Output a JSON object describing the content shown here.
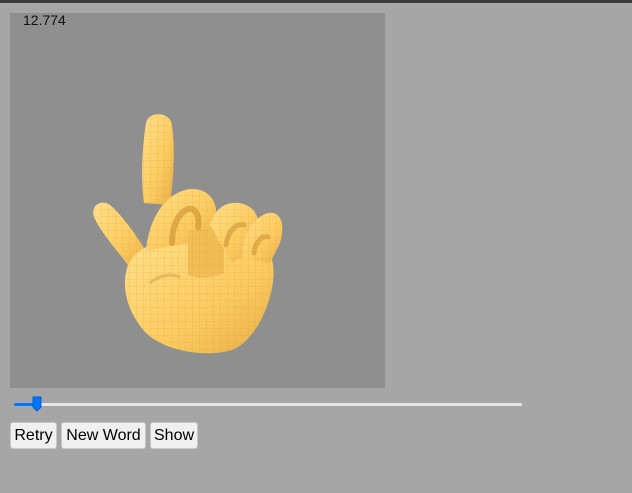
{
  "viewer": {
    "timer": "12.774",
    "model": "hand-sign-3d-model"
  },
  "slider": {
    "value_fraction": 0.027
  },
  "buttons": {
    "retry": "Retry",
    "new_word": "New Word",
    "show": "Show"
  },
  "colors": {
    "page_bg": "#a6a6a6",
    "viewport_bg": "#8f8f8f",
    "hand_base": "#fdd067",
    "hand_shadow": "#d99a3c",
    "slider_accent": "#0075ff"
  }
}
